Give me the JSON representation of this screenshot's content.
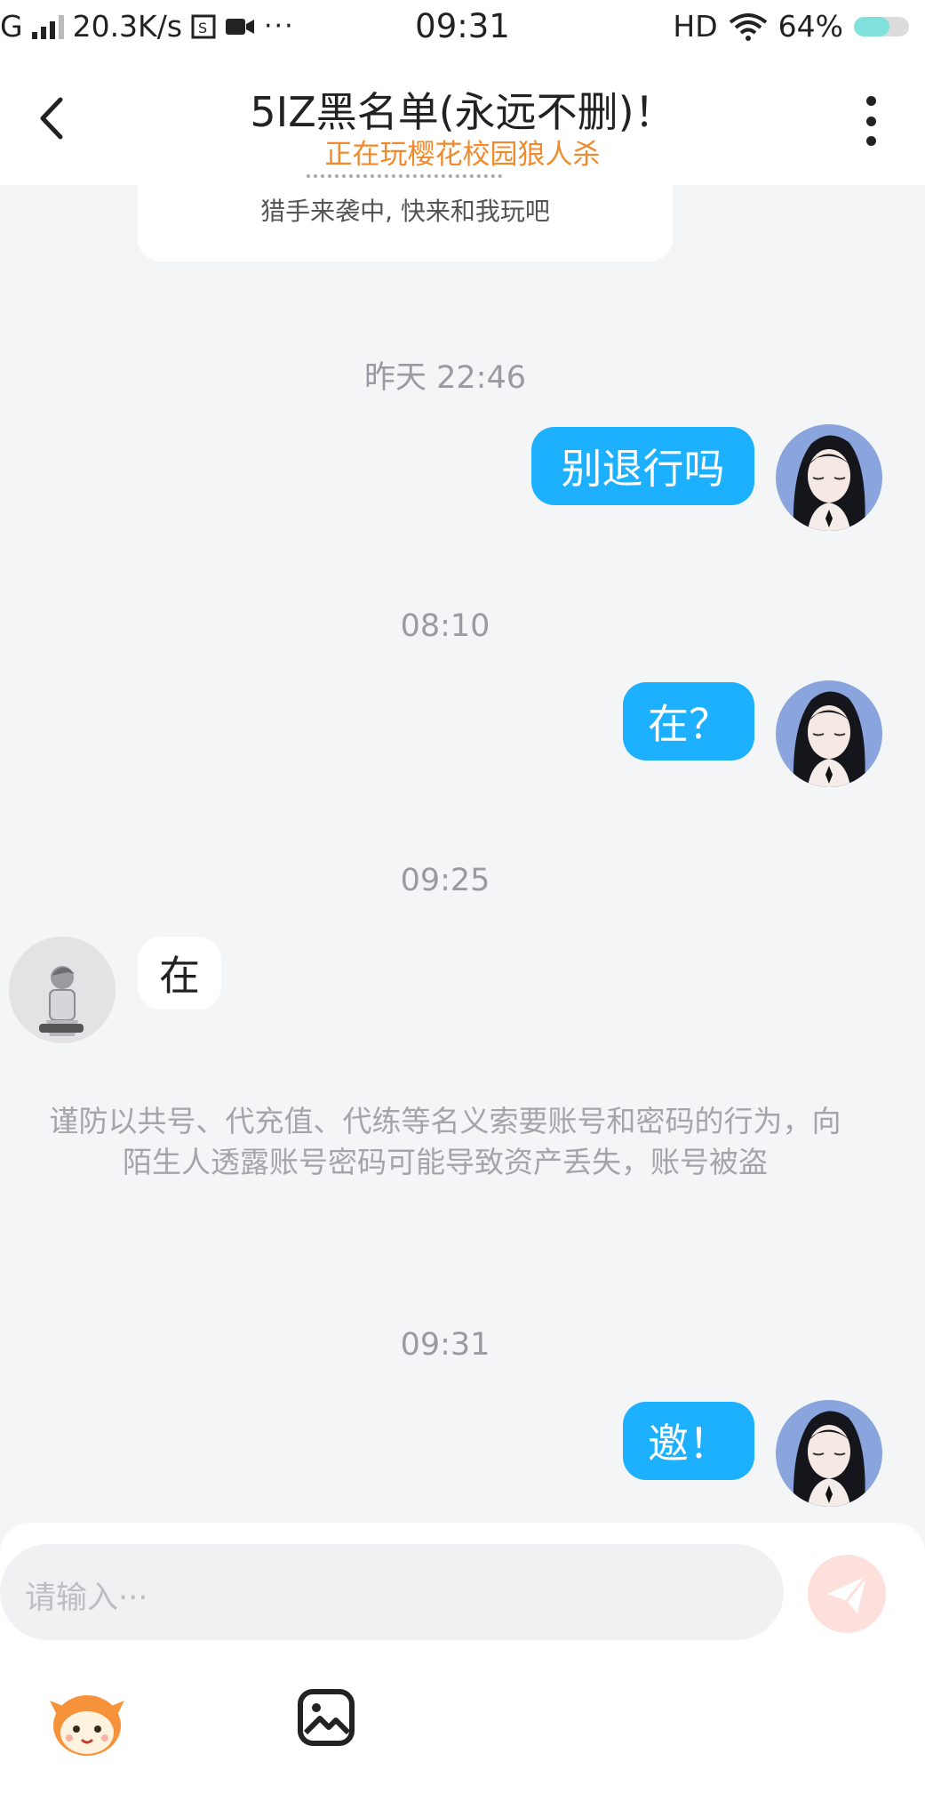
{
  "status_bar": {
    "network": "G",
    "speed": "20.3K/s",
    "time": "09:31",
    "hd": "HD",
    "battery_percent": "64%",
    "battery_level": 0.64,
    "icons": [
      "signal-icon",
      "sim-icon",
      "video-icon",
      "more-dots-icon",
      "wifi-icon",
      "battery-icon"
    ]
  },
  "header": {
    "title": "5IZ黑名单(永远不删)！",
    "subtitle": "正在玩樱花校园狼人杀",
    "subtitle_color": "#f08a2a"
  },
  "card": {
    "text": "猎手来袭中, 快来和我玩吧"
  },
  "timestamps": [
    "昨天 22:46",
    "08:10",
    "09:25",
    "09:31"
  ],
  "messages": [
    {
      "from": "me",
      "text": "别退行吗"
    },
    {
      "from": "me",
      "text": "在？"
    },
    {
      "from": "other",
      "text": "在"
    },
    {
      "from": "me",
      "text": "邀！"
    }
  ],
  "notice": "谨防以共号、代充值、代练等名义索要账号和密码的行为，向陌生人透露账号密码可能导致资产丢失，账号被盗",
  "composer": {
    "placeholder": "请输入···",
    "tools": [
      "emoji-mascot-icon",
      "image-icon"
    ],
    "send_icon": "paper-plane-icon"
  },
  "colors": {
    "bubble_me": "#1db0ff",
    "background": "#f4f5f7",
    "accent": "#f08a2a"
  }
}
